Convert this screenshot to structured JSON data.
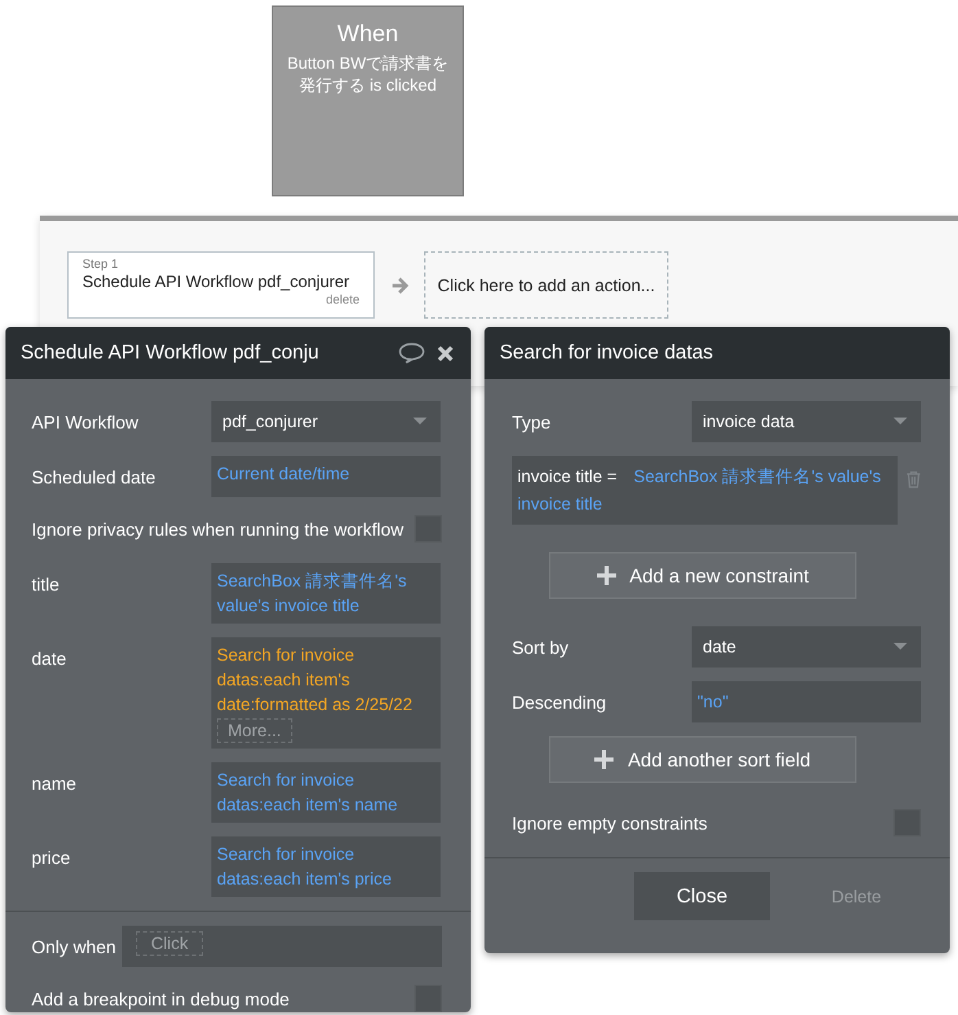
{
  "event": {
    "title": "When",
    "description": "Button BWで請求書を発行する is clicked"
  },
  "steps": [
    {
      "step_label": "Step 1",
      "name": "Schedule API Workflow pdf_conjurer",
      "delete": "delete"
    }
  ],
  "add_action": "Click here to add an action...",
  "action_panel": {
    "title": "Schedule API Workflow pdf_conju",
    "fields": [
      {
        "kind": "dropdown",
        "label": "API Workflow",
        "value": "pdf_conjurer"
      },
      {
        "kind": "expression",
        "label": "Scheduled date",
        "value": "Current date/time",
        "warning": false
      },
      {
        "kind": "checkbox",
        "label": "Ignore privacy rules when running the workflow",
        "checked": false
      },
      {
        "kind": "expression",
        "label": "title",
        "value": "SearchBox 請求書件名's value's invoice title",
        "warning": false
      },
      {
        "kind": "expression",
        "label": "date",
        "value": "Search for invoice datas:each item's date:formatted as 2/25/22",
        "warning": true,
        "more": "More..."
      },
      {
        "kind": "expression",
        "label": "name",
        "value": "Search for invoice datas:each item's name",
        "warning": false
      },
      {
        "kind": "expression",
        "label": "price",
        "value": "Search for invoice datas:each item's price",
        "warning": false
      }
    ],
    "only_when": {
      "label": "Only when",
      "placeholder": "Click"
    },
    "breakpoint": {
      "label": "Add a breakpoint in debug mode",
      "checked": false
    }
  },
  "search_panel": {
    "title": "Search for invoice datas",
    "type": {
      "label": "Type",
      "value": "invoice data"
    },
    "constraints": [
      {
        "field": "invoice title =",
        "value": "SearchBox 請求書件名's value's invoice title"
      }
    ],
    "add_constraint": "Add a new constraint",
    "sort_by": {
      "label": "Sort by",
      "value": "date"
    },
    "descending": {
      "label": "Descending",
      "value": "\"no\""
    },
    "add_sort": "Add another sort field",
    "ignore_empty": {
      "label": "Ignore empty constraints",
      "checked": false
    },
    "buttons": [
      {
        "label": "Close",
        "disabled": false
      },
      {
        "label": "Delete",
        "disabled": true
      }
    ]
  }
}
